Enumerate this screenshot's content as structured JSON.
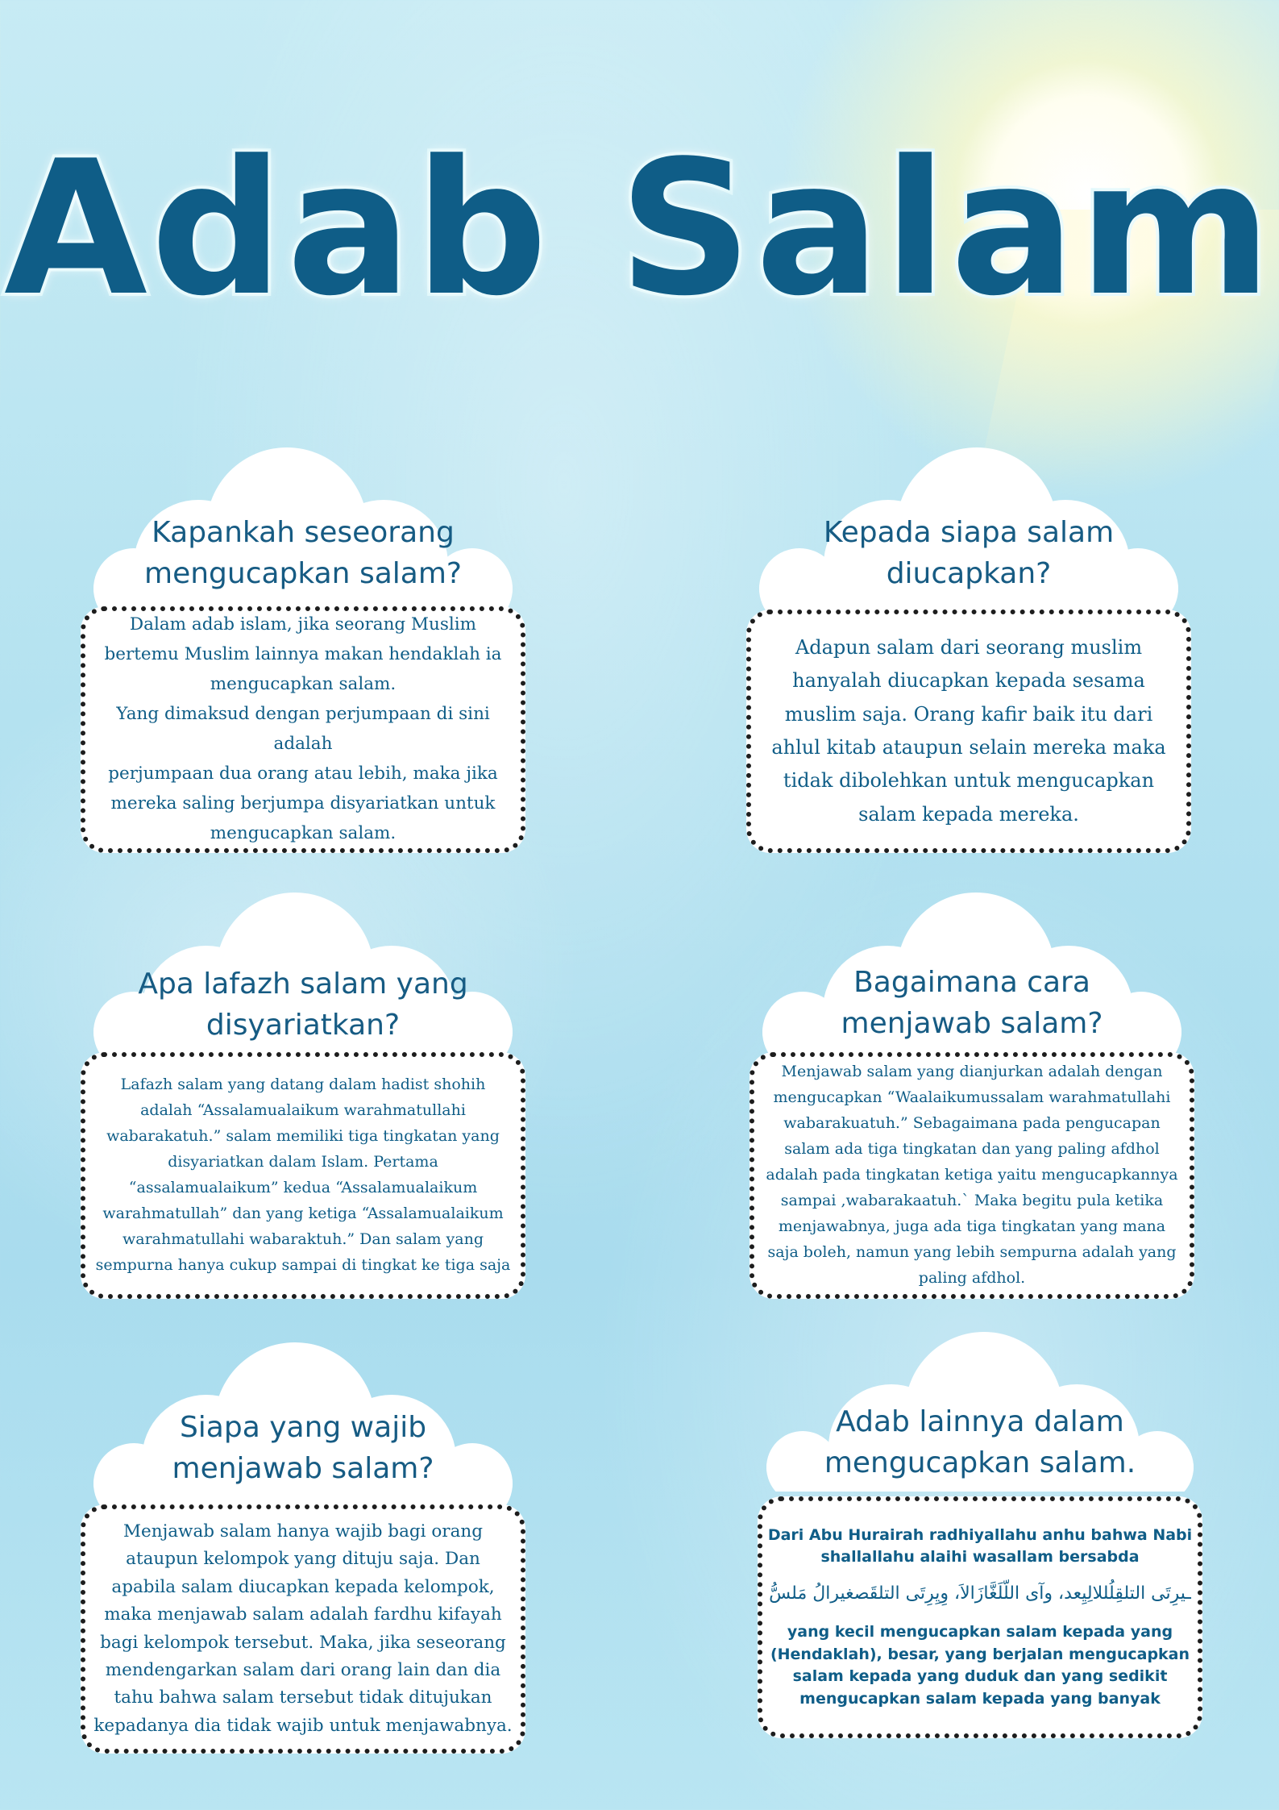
{
  "poster": {
    "title": "Adab Salam"
  },
  "cards": [
    {
      "title": "Kapankah seseorang mengucapkan salam?",
      "body": "Dalam adab islam, jika seorang Muslim bertemu Muslim lainnya makan hendaklah ia mengucapkan salam.\nYang dimaksud dengan perjumpaan di sini adalah\nperjumpaan dua orang atau lebih, maka jika mereka saling berjumpa disyariatkan untuk mengucapkan salam."
    },
    {
      "title": "Kepada siapa salam diucapkan?",
      "body": "Adapun salam dari seorang muslim hanyalah diucapkan kepada sesama muslim saja. Orang kafir baik itu dari ahlul kitab ataupun selain mereka maka tidak dibolehkan untuk mengucapkan salam kepada mereka."
    },
    {
      "title": "Apa lafazh salam yang disyariatkan?",
      "body": "Lafazh salam yang datang dalam hadist shohih adalah “Assalamualaikum warahmatullahi wabarakatuh.” salam memiliki tiga tingkatan yang disyariatkan dalam Islam. Pertama “assalamualaikum” kedua “Assalamualaikum warahmatullah” dan yang ketiga “Assalamualaikum warahmatullahi wabaraktuh.” Dan salam yang sempurna hanya cukup sampai di tingkat ke tiga saja"
    },
    {
      "title": "Bagaimana cara menjawab salam?",
      "body": "Menjawab salam yang dianjurkan adalah dengan mengucapkan “Waalaikumussalam warahmatullahi wabarakuatuh.” Sebagaimana pada pengucapan salam ada tiga tingkatan dan yang paling afdhol adalah pada tingkatan ketiga yaitu mengucapkannya sampai ,wabarakaatuh.` Maka begitu pula ketika menjawabnya, juga ada tiga tingkatan yang mana saja boleh, namun yang lebih sempurna adalah yang paling afdhol."
    },
    {
      "title": "Siapa yang wajib menjawab salam?",
      "body": "Menjawab salam hanya wajib bagi orang ataupun kelompok yang dituju saja. Dan apabila salam diucapkan kepada kelompok, maka menjawab salam adalah fardhu kifayah bagi kelompok tersebut. Maka, jika seseorang mendengarkan salam dari orang lain dan dia tahu bahwa salam tersebut tidak ditujukan kepadanya dia tidak wajib untuk menjawabnya."
    },
    {
      "title": "Adab lainnya dalam mengucapkan salam.",
      "hadith_intro": "Dari Abu Hurairah radhiyallahu anhu bahwa Nabi shallallahu alaihi wasallam bersabda",
      "arabic": "ـيرِتَى التلقِلُللالِيِعد، وآى اللّلَغَّازَالاَ، وِيِرِتَى التلقَصغيرالُ مَلسُّ",
      "hadith_translation": "yang kecil mengucapkan salam kepada yang (Hendaklah), besar, yang berjalan mengucapkan salam kepada yang duduk dan yang sedikit mengucapkan salam kepada yang banyak"
    }
  ]
}
